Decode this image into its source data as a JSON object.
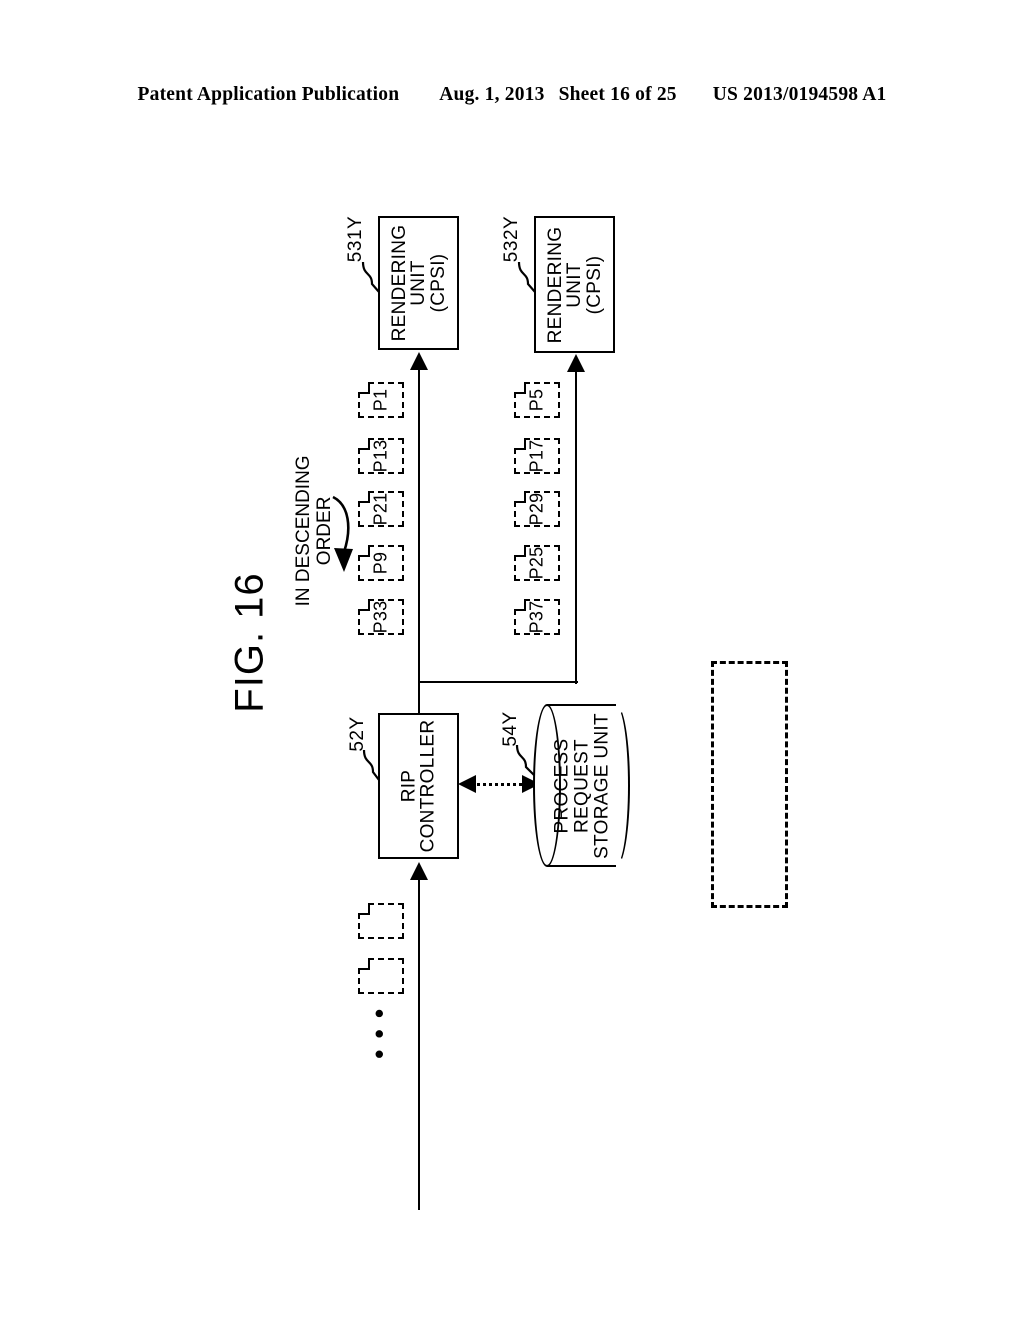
{
  "header": {
    "publication": "Patent Application Publication",
    "date": "Aug. 1, 2013",
    "sheet": "Sheet 16 of 25",
    "patent_number": "US 2013/0194598 A1"
  },
  "figure": {
    "label": "FIG. 16"
  },
  "blocks": {
    "rendering_unit_1": {
      "ref": "531Y",
      "line1": "RENDERING",
      "line2": "UNIT",
      "line3": "(CPSI)"
    },
    "rendering_unit_2": {
      "ref": "532Y",
      "line1": "RENDERING",
      "line2": "UNIT",
      "line3": "(CPSI)"
    },
    "rip_controller": {
      "ref": "52Y",
      "line1": "RIP",
      "line2": "CONTROLLER"
    },
    "process_request_storage": {
      "ref": "54Y",
      "line1": "PROCESS",
      "line2": "REQUEST",
      "line3": "STORAGE UNIT"
    }
  },
  "annotations": {
    "descending_order_line1": "IN DESCENDING",
    "descending_order_line2": "ORDER",
    "ellipsis": "• • •"
  },
  "queues": {
    "queue_1_label": "queue-to-rendering-unit-531Y",
    "queue_1_pages": [
      "P1",
      "P13",
      "P21",
      "P9",
      "P33"
    ],
    "queue_2_label": "queue-to-rendering-unit-532Y",
    "queue_2_pages": [
      "P5",
      "P17",
      "P29",
      "P25",
      "P37"
    ],
    "input_pages": [
      "",
      ""
    ]
  },
  "colors": {
    "ink": "#000000",
    "paper": "#ffffff"
  }
}
